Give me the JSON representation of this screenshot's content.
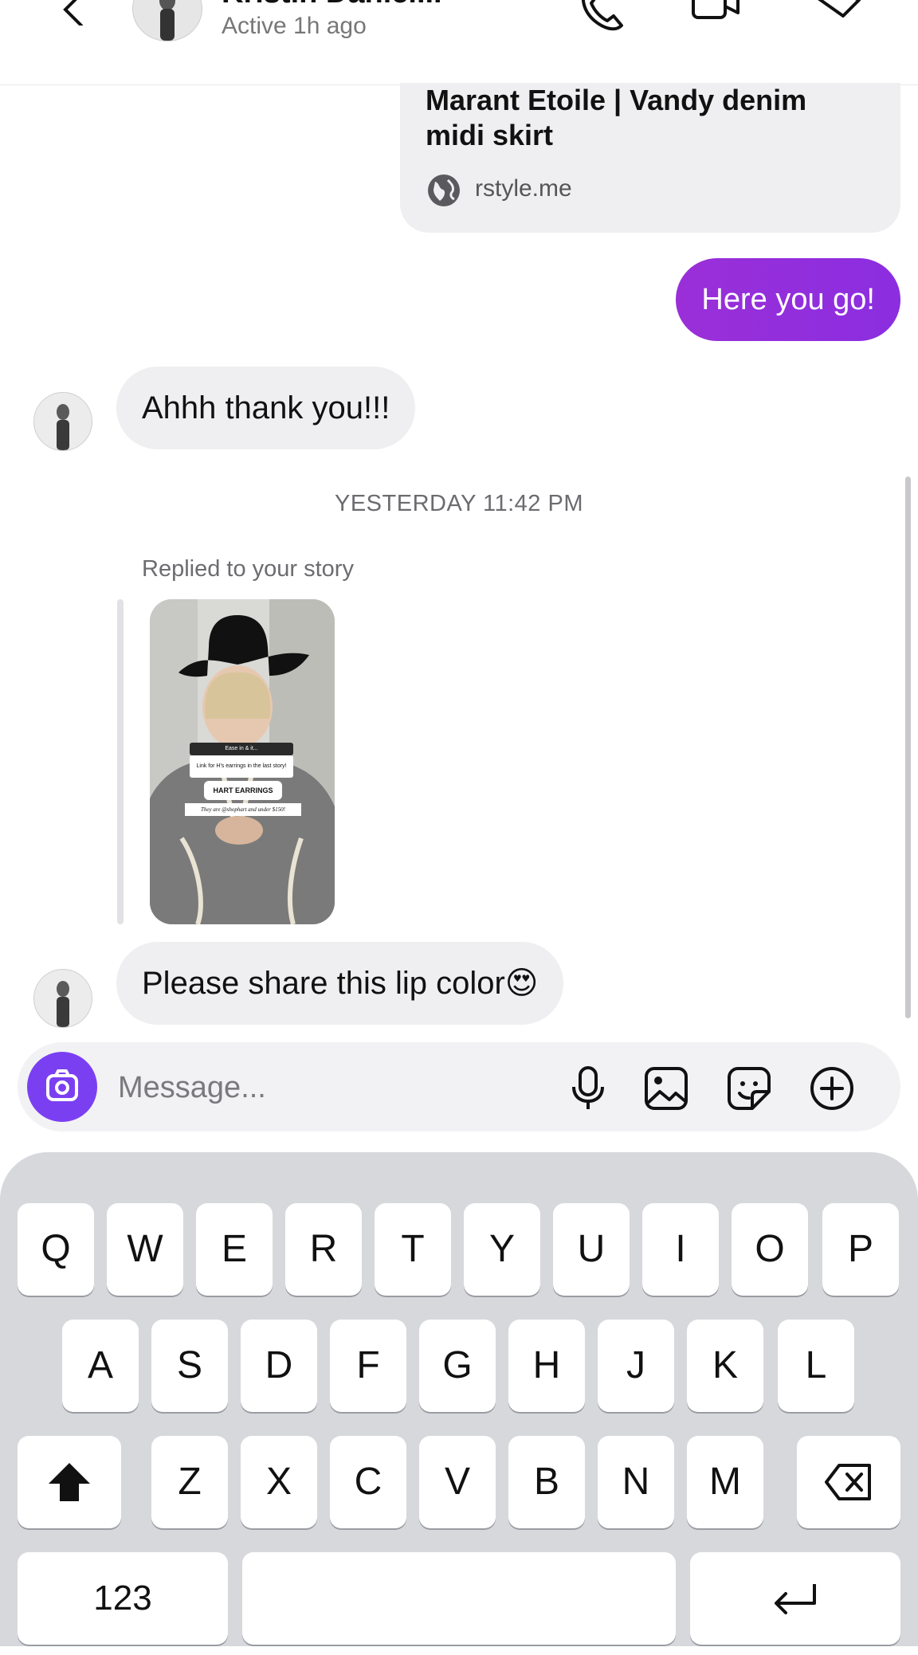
{
  "header": {
    "contact_name": "Kristin Daniel...",
    "status": "Active 1h ago"
  },
  "link_card": {
    "title": "Marant Etoile | Vandy denim midi skirt",
    "domain": "rstyle.me"
  },
  "messages": {
    "outgoing_1": "Here you go!",
    "incoming_1": "Ahhh thank you!!!",
    "timestamp": "YESTERDAY 11:42 PM",
    "reply_label": "Replied to your story",
    "incoming_2": "Please share this lip color😍"
  },
  "story": {
    "line1": "Ease in & it...",
    "line2": "Link for H's earrings in the last story!",
    "sticker": "HART EARRINGS",
    "line3": "They are @shophart and under $150!"
  },
  "composer": {
    "placeholder": "Message..."
  },
  "keyboard": {
    "row1": [
      "Q",
      "W",
      "E",
      "R",
      "T",
      "Y",
      "U",
      "I",
      "O",
      "P"
    ],
    "row2": [
      "A",
      "S",
      "D",
      "F",
      "G",
      "H",
      "J",
      "K",
      "L"
    ],
    "row3": [
      "Z",
      "X",
      "C",
      "V",
      "B",
      "N",
      "M"
    ],
    "numbers_key": "123"
  },
  "colors": {
    "outgoing_bubble": "#8b2ee0",
    "camera_button": "#7b3ff2",
    "keyboard_bg": "#d7d8dc"
  }
}
